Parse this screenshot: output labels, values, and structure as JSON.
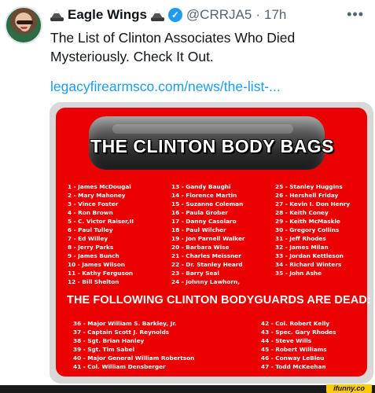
{
  "tweet": {
    "display_name": "Eagle Wings",
    "handle": "@CRRJA5",
    "separator": "·",
    "time": "17h",
    "more": "•••",
    "text": "The List of Clinton Associates Who Died Mysteriously. Check It Out.",
    "link": "legacyfirearmsco.com/news/the-list-..."
  },
  "image": {
    "title": "THE CLINTON BODY BAGS",
    "col1": [
      "1 - James McDougal",
      "2 - Mary Mahoney",
      "3 - Vince Foster",
      "4 - Ron Brown",
      "5 - C. Victor Raiser,II",
      "6 - Paul Tulley",
      "7 - Ed Willey",
      "8 - Jerry Parks",
      "9 - James Bunch",
      "10 - James Wilson",
      "11 - Kathy Ferguson",
      "12 - Bill Shelton"
    ],
    "col2": [
      "13 - Gandy Baughi",
      "14 - Florence Martin",
      "15 - Suzanne Coleman",
      "16 - Paula Grober",
      "17 - Danny Casolaro",
      "18 - Paul Wilcher",
      "19 - Jon Parnell Walker",
      "20 - Barbara Wise",
      "21 - Charles Meissner",
      "22 - Dr. Stanley Heard",
      "23 - Barry Seal",
      "24 - Johnny Lawhorn,"
    ],
    "col3": [
      "25 - Stanley Huggins",
      "26 - Hershell Friday",
      "27 - Kevin I. Don Henry",
      "28 - Keith Coney",
      "29 - Keith McMaskle",
      "30 - Gregory Collins",
      "31 - Jeff Rhodes",
      "32 - James Milan",
      "33 - Jordan Kettleson",
      "34 - Richard Winters",
      "35 - John Ashe"
    ],
    "guards_title": "THE FOLLOWING CLINTON BODYGUARDS ARE DEAD:",
    "guards_col1": [
      "36 - Major William S. Barkley, Jr.",
      "37 - Captain Scott J. Reynolds",
      "38 - Sgt. Brian Hanley",
      "39 - Sgt. Tim Sabel",
      "40 - Major General William Robertson",
      "41 - Col. William Densberger"
    ],
    "guards_col2": [
      "42 - Col. Robert Kelly",
      "43 - Spec. Gary Rhodes",
      "44 - Steve Wills",
      "45 - Robert Williams",
      "46 - Conway LeBleu",
      "47 - Todd McKeehan"
    ]
  },
  "watermark": "ifunny.co",
  "colors": {
    "board_red": "#ea0000",
    "link_blue": "#1d9bf0",
    "verified_blue": "#1d9bf0",
    "muted_gray": "#536471"
  },
  "icons": [
    "avatar",
    "mountain-emoji-icon",
    "verified-badge-icon",
    "more-options-icon"
  ]
}
